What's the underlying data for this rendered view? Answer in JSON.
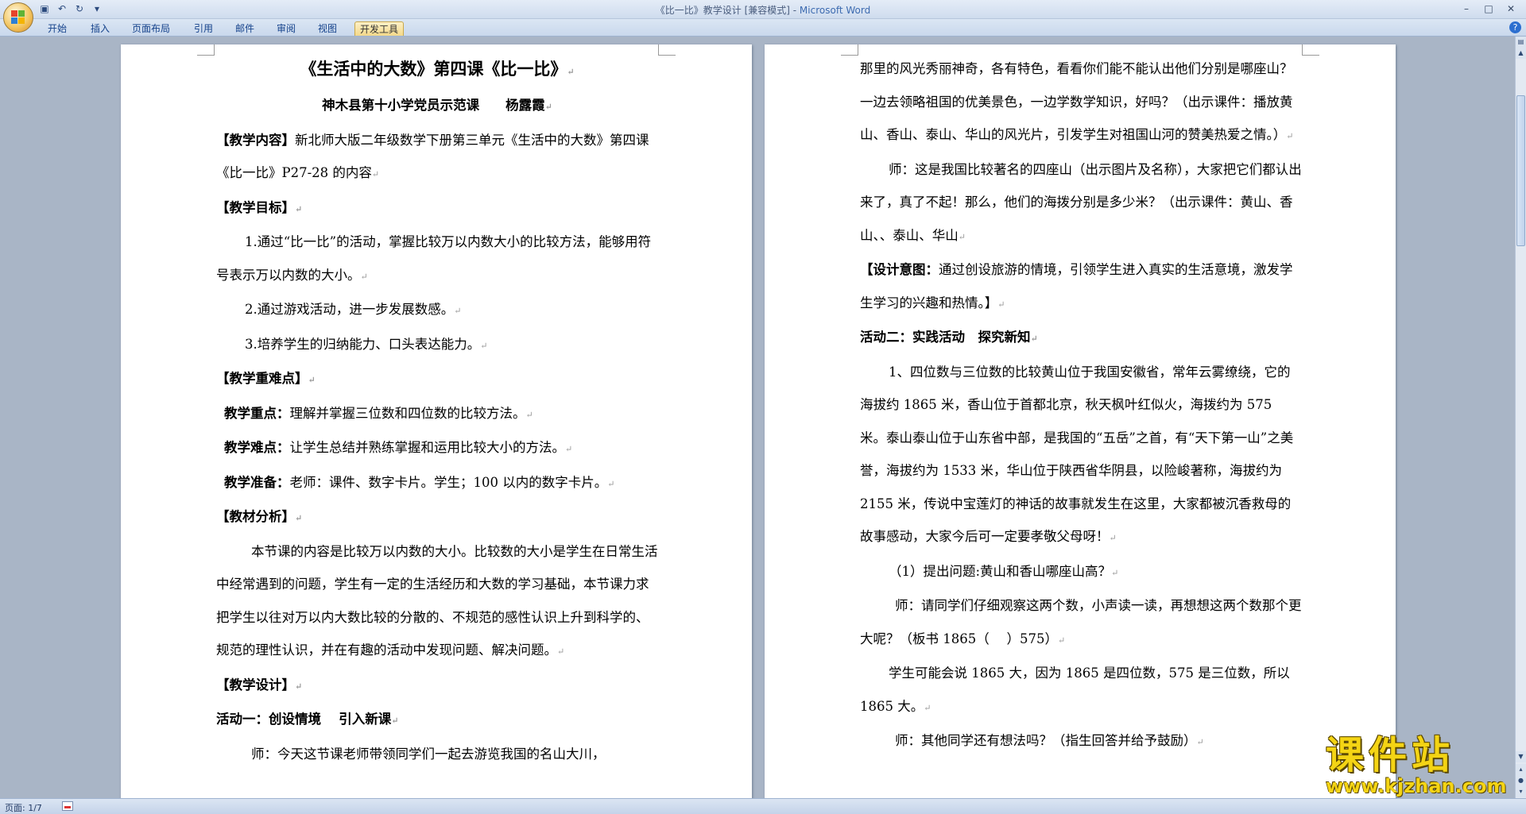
{
  "window": {
    "title_doc": "《比一比》教学设计 [兼容模式] - ",
    "title_app": "Microsoft Word"
  },
  "ribbon": {
    "tabs": [
      "开始",
      "插入",
      "页面布局",
      "引用",
      "邮件",
      "审阅",
      "视图",
      "开发工具"
    ],
    "active_tab": "开发工具"
  },
  "status": {
    "page": "页面: 1/7"
  },
  "watermark": {
    "name": "课件站",
    "url": "www.kjzhan.com"
  },
  "page_left": {
    "title": "《生活中的大数》第四课《比一比》",
    "subtitle": "神木县第十小学党员示范课　　杨露霞",
    "p1_label": "【教学内容】",
    "p1_text": "新北师大版二年级数学下册第三单元《生活中的大数》第四课《比一比》P27-28 的内容",
    "p2_label": "【教学目标】",
    "goal1": "1.通过“比一比”的活动，掌握比较万以内数大小的比较方法，能够用符号表示万以内数的大小。",
    "goal2": "2.通过游戏活动，进一步发展数感。",
    "goal3": "3.培养学生的归纳能力、口头表达能力。",
    "p3_label": "【教学重难点】",
    "key_label": "教学重点：",
    "key_text": "理解并掌握三位数和四位数的比较方法。",
    "diff_label": "教学难点：",
    "diff_text": "让学生总结并熟练掌握和运用比较大小的方法。",
    "prep_label": "教学准备：",
    "prep_text": "老师：课件、数字卡片。学生；100 以内的数字卡片。",
    "p4_label": "【教材分析】",
    "analysis": "本节课的内容是比较万以内数的大小。比较数的大小是学生在日常生活中经常遇到的问题，学生有一定的生活经历和大数的学习基础，本节课力求把学生以往对万以内大数比较的分散的、不规范的感性认识上升到科学的、规范的理性认识，并在有趣的活动中发现问题、解决问题。",
    "p5_label": "【教学设计】",
    "act1": "活动一：创设情境　 引入新课",
    "act1_text": "师：今天这节课老师带领同学们一起去游览我国的名山大川，"
  },
  "page_right": {
    "r1": "那里的风光秀丽神奇，各有特色，看看你们能不能认出他们分别是哪座山？一边去领略祖国的优美景色，一边学数学知识，好吗？（出示课件：播放黄山、香山、泰山、华山的风光片，引发学生对祖国山河的赞美热爱之情。）",
    "r2": "师：这是我国比较著名的四座山（出示图片及名称），大家把它们都认出来了，真了不起！那么，他们的海拨分别是多少米？（出示课件：黄山、香山、、泰山、华山",
    "r3_label": "【设计意图：",
    "r3_text": "通过创设旅游的情境，引领学生进入真实的生活意境，激发学生学习的兴趣和热情。】",
    "act2": "活动二：实践活动　探究新知",
    "r4": "1、四位数与三位数的比较黄山位于我国安徽省，常年云雾缭绕，它的海拔约 1865 米，香山位于首都北京，秋天枫叶红似火，海拨约为 575 米。泰山泰山位于山东省中部，是我国的“五岳”之首，有“天下第一山”之美誉，海拔约为 1533 米，华山位于陕西省华阴县，以险峻著称，海拔约为 2155 米，传说中宝莲灯的神话的故事就发生在这里，大家都被沉香救母的故事感动，大家今后可一定要孝敬父母呀！",
    "r5": "（1）提出问题:黄山和香山哪座山高？",
    "r6": "师：请同学们仔细观察这两个数，小声读一读，再想想这两个数那个更大呢？（板书 1865（　 ）575）",
    "r7": "学生可能会说 1865 大，因为 1865 是四位数，575 是三位数，所以 1865 大。",
    "r8": "师：其他同学还有想法吗？（指生回答并给予鼓励）"
  },
  "marks": {
    "para": "↵"
  }
}
